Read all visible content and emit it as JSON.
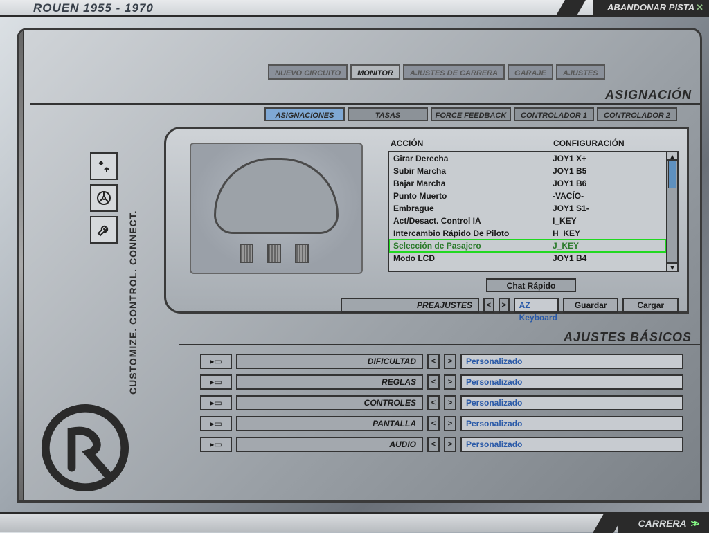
{
  "topbar": {
    "title": "ROUEN 1955 - 1970",
    "abandon": "ABANDONAR PISTA"
  },
  "sidebar_text": "CUSTOMIZE. CONTROL. CONNECT.",
  "main_tabs": {
    "nuevo": "NUEVO CIRCUITO",
    "monitor": "MONITOR",
    "ajustes_carrera": "AJUSTES DE CARRERA",
    "garaje": "GARAJE",
    "ajustes": "AJUSTES"
  },
  "section": {
    "asignacion": "ASIGNACIÓN",
    "basicos": "AJUSTES BÁSICOS"
  },
  "subtabs": {
    "asignaciones": "ASIGNACIONES",
    "tasas": "TASAS",
    "ff": "FORCE FEEDBACK",
    "c1": "CONTROLADOR 1",
    "c2": "CONTROLADOR 2"
  },
  "bindings": {
    "hdr_action": "ACCIÓN",
    "hdr_config": "CONFIGURACIÓN",
    "rows": [
      {
        "action": "Girar Derecha",
        "config": "JOY1 X+"
      },
      {
        "action": "Subir Marcha",
        "config": "JOY1 B5"
      },
      {
        "action": "Bajar Marcha",
        "config": "JOY1 B6"
      },
      {
        "action": "Punto Muerto",
        "config": "-VACÍO-"
      },
      {
        "action": "Embrague",
        "config": "JOY1 S1-"
      },
      {
        "action": "Act/Desact. Control IA",
        "config": "I_KEY"
      },
      {
        "action": "Intercambio Rápido De Piloto",
        "config": "H_KEY"
      },
      {
        "action": "Selección de Pasajero",
        "config": "J_KEY"
      },
      {
        "action": "Modo LCD",
        "config": "JOY1 B4"
      }
    ],
    "selected_index": 7
  },
  "chat_btn": "Chat Rápido",
  "preset": {
    "label": "PREAJUSTES",
    "value": "AZ Keyboard",
    "save": "Guardar",
    "load": "Cargar"
  },
  "basics": {
    "rows": [
      {
        "label": "DIFICULTAD",
        "value": "Personalizado"
      },
      {
        "label": "REGLAS",
        "value": "Personalizado"
      },
      {
        "label": "CONTROLES",
        "value": "Personalizado"
      },
      {
        "label": "PANTALLA",
        "value": "Personalizado"
      },
      {
        "label": "AUDIO",
        "value": "Personalizado"
      }
    ]
  },
  "bottom": {
    "carrera": "CARRERA"
  }
}
